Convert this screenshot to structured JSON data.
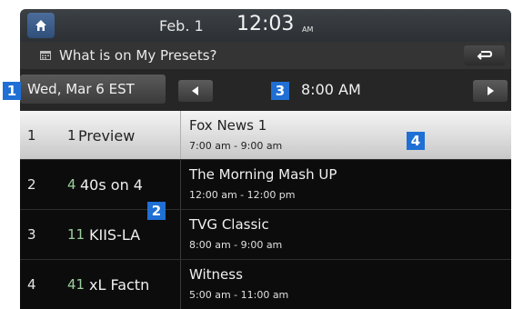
{
  "status_bar": {
    "date": "Feb.  1",
    "time": "12:03",
    "ampm": "AM"
  },
  "title_bar": {
    "title": "What is on My Presets?"
  },
  "nav": {
    "day": "Wed, Mar 6 EST",
    "time": "8:00 AM"
  },
  "callouts": [
    "1",
    "2",
    "3",
    "4"
  ],
  "presets": [
    {
      "index": "1",
      "channel": "1",
      "name": "Preview",
      "show": "Fox News 1",
      "time": "7:00 am - 9:00 am",
      "selected": true
    },
    {
      "index": "2",
      "channel": "4",
      "name": "40s on 4",
      "show": "The Morning Mash UP",
      "time": "12:00 am - 12:00 pm"
    },
    {
      "index": "3",
      "channel": "11",
      "name": "KIIS-LA",
      "show": "TVG Classic",
      "time": "8:00 am - 9:00 am"
    },
    {
      "index": "4",
      "channel": "41",
      "name": "xL Factn",
      "show": "Witness",
      "time": "5:00 am - 11:00 am"
    }
  ],
  "colors": {
    "callout": "#1f6fd4",
    "channel_number": "#9ccf9c"
  }
}
